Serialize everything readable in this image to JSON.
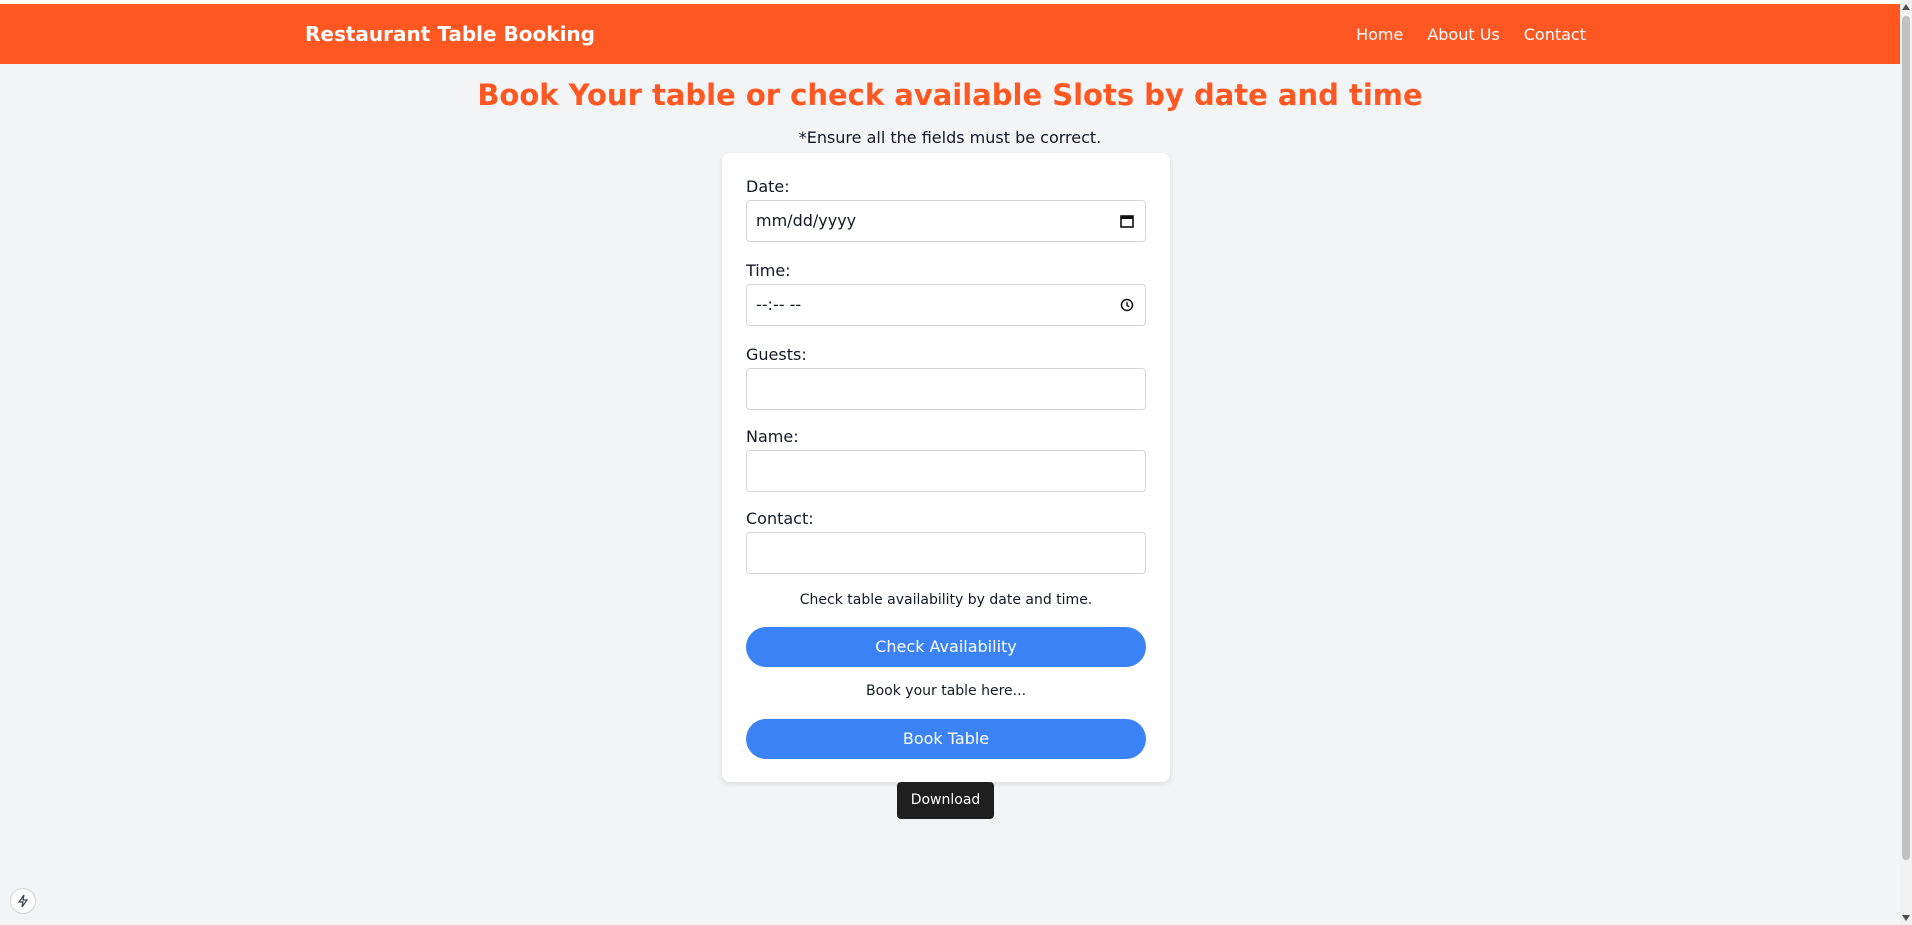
{
  "navbar": {
    "brand": "Restaurant Table Booking",
    "links": [
      "Home",
      "About Us",
      "Contact"
    ],
    "color": "#ff5722"
  },
  "main": {
    "heading": "Book Your table or check available Slots by date and time",
    "note": "*Ensure all the fields must be correct."
  },
  "form": {
    "date_label": "Date:",
    "date_placeholder": "mm/dd/yyyy",
    "time_label": "Time:",
    "time_placeholder": "--:-- --",
    "guests_label": "Guests:",
    "name_label": "Name:",
    "contact_label": "Contact:",
    "check_helper": "Check table availability by date and time.",
    "check_button": "Check Availability",
    "book_helper": "Book your table here...",
    "book_button": "Book Table",
    "button_color": "#3b82f6"
  },
  "download_label": "Download",
  "icons": {
    "date": "calendar-icon",
    "time": "clock-icon",
    "corner": "bolt-icon"
  }
}
